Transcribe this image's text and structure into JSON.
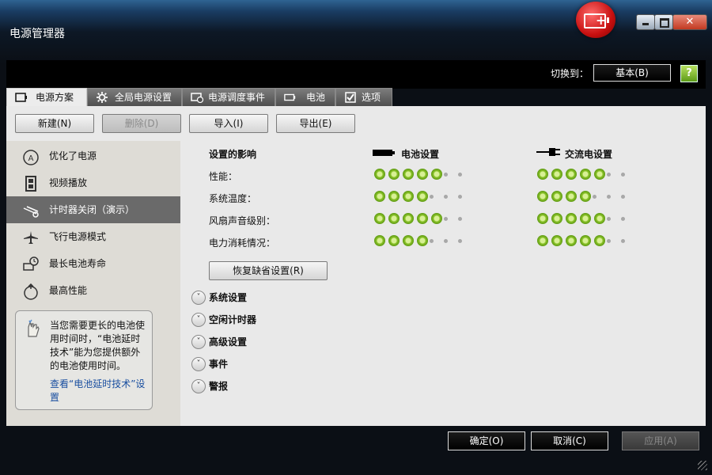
{
  "window": {
    "title": "电源管理器",
    "controls": {
      "minimize": "minimize",
      "maximize": "maximize",
      "close": "✕"
    }
  },
  "header": {
    "switch_label": "切换到：",
    "basic_button": "基本(B)",
    "help_icon": "?"
  },
  "tabs": [
    {
      "label": "电源方案",
      "icon": "battery-outline-icon",
      "active": true
    },
    {
      "label": "全局电源设置",
      "icon": "gear-icon",
      "active": false
    },
    {
      "label": "电源调度事件",
      "icon": "schedule-icon",
      "active": false
    },
    {
      "label": "电池",
      "icon": "battery-icon",
      "active": false
    },
    {
      "label": "选项",
      "icon": "checkbox-icon",
      "active": false
    }
  ],
  "toolbar": {
    "new": "新建(N)",
    "delete": "删除(D)",
    "import": "导入(I)",
    "export": "导出(E)"
  },
  "sidebar": {
    "items": [
      {
        "label": "优化了电源",
        "icon": "a-badge-icon",
        "selected": false
      },
      {
        "label": "视频播放",
        "icon": "film-icon",
        "selected": false
      },
      {
        "label": "计时器关闭（演示）",
        "icon": "projector-icon",
        "selected": true
      },
      {
        "label": "飞行电源模式",
        "icon": "airplane-icon",
        "selected": false
      },
      {
        "label": "最长电池寿命",
        "icon": "battery-clock-icon",
        "selected": false
      },
      {
        "label": "最高性能",
        "icon": "power-icon",
        "selected": false
      }
    ],
    "tip": {
      "text": "当您需要更长的电池使用时间时，“电池延时技术”能为您提供额外的电池使用时间。",
      "link": "查看“电池延时技术”设置"
    }
  },
  "impact": {
    "header": "设置的影响",
    "battery_header": "电池设置",
    "ac_header": "交流电设置",
    "max_level": 7,
    "rows": [
      {
        "label": "性能：",
        "battery": 5,
        "ac": 5
      },
      {
        "label": "系统温度：",
        "battery": 4,
        "ac": 4
      },
      {
        "label": "风扇声音级别：",
        "battery": 5,
        "ac": 5
      },
      {
        "label": "电力消耗情况：",
        "battery": 4,
        "ac": 5
      }
    ],
    "restore_button": "恢复缺省设置(R)"
  },
  "sections": [
    {
      "label": "系统设置"
    },
    {
      "label": "空闲计时器"
    },
    {
      "label": "高级设置"
    },
    {
      "label": "事件"
    },
    {
      "label": "警报"
    }
  ],
  "footer": {
    "ok": "确定(O)",
    "cancel": "取消(C)",
    "apply": "应用(A)"
  }
}
